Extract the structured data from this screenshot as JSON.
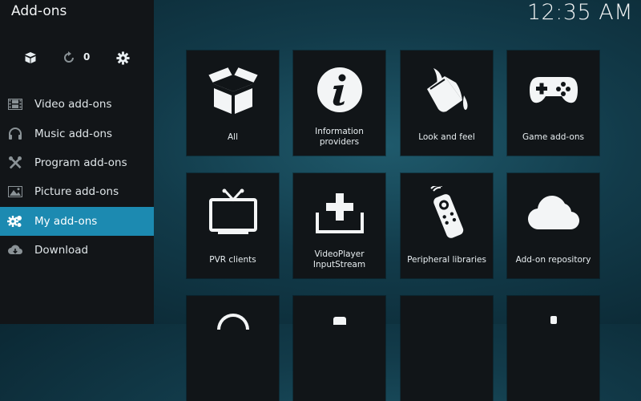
{
  "header": {
    "title": "Add-ons",
    "clock": "12:35 AM"
  },
  "top_icons": {
    "box_icon": "open-box-icon",
    "refresh_icon": "refresh-icon",
    "update_count": "0",
    "settings_icon": "gear-icon"
  },
  "menu": {
    "items": [
      {
        "label": "Video add-ons",
        "icon": "film-icon"
      },
      {
        "label": "Music add-ons",
        "icon": "headphones-icon"
      },
      {
        "label": "Program add-ons",
        "icon": "tools-icon"
      },
      {
        "label": "Picture add-ons",
        "icon": "picture-icon"
      },
      {
        "label": "My add-ons",
        "icon": "gears-icon",
        "active": true
      },
      {
        "label": "Download",
        "icon": "cloud-download-icon"
      }
    ]
  },
  "tiles": [
    {
      "label": "All",
      "icon": "open-box-icon"
    },
    {
      "label": "Information providers",
      "icon": "info-icon"
    },
    {
      "label": "Look and feel",
      "icon": "paint-bucket-icon"
    },
    {
      "label": "Game add-ons",
      "icon": "gamepad-icon"
    },
    {
      "label": "PVR clients",
      "icon": "tv-icon"
    },
    {
      "label": "VideoPlayer InputStream",
      "icon": "inputstream-icon"
    },
    {
      "label": "Peripheral libraries",
      "icon": "remote-icon"
    },
    {
      "label": "Add-on repository",
      "icon": "cloud-icon"
    }
  ],
  "colors": {
    "accent": "#1c8ab1",
    "sidebar": "#121518",
    "tile": "#111518"
  }
}
